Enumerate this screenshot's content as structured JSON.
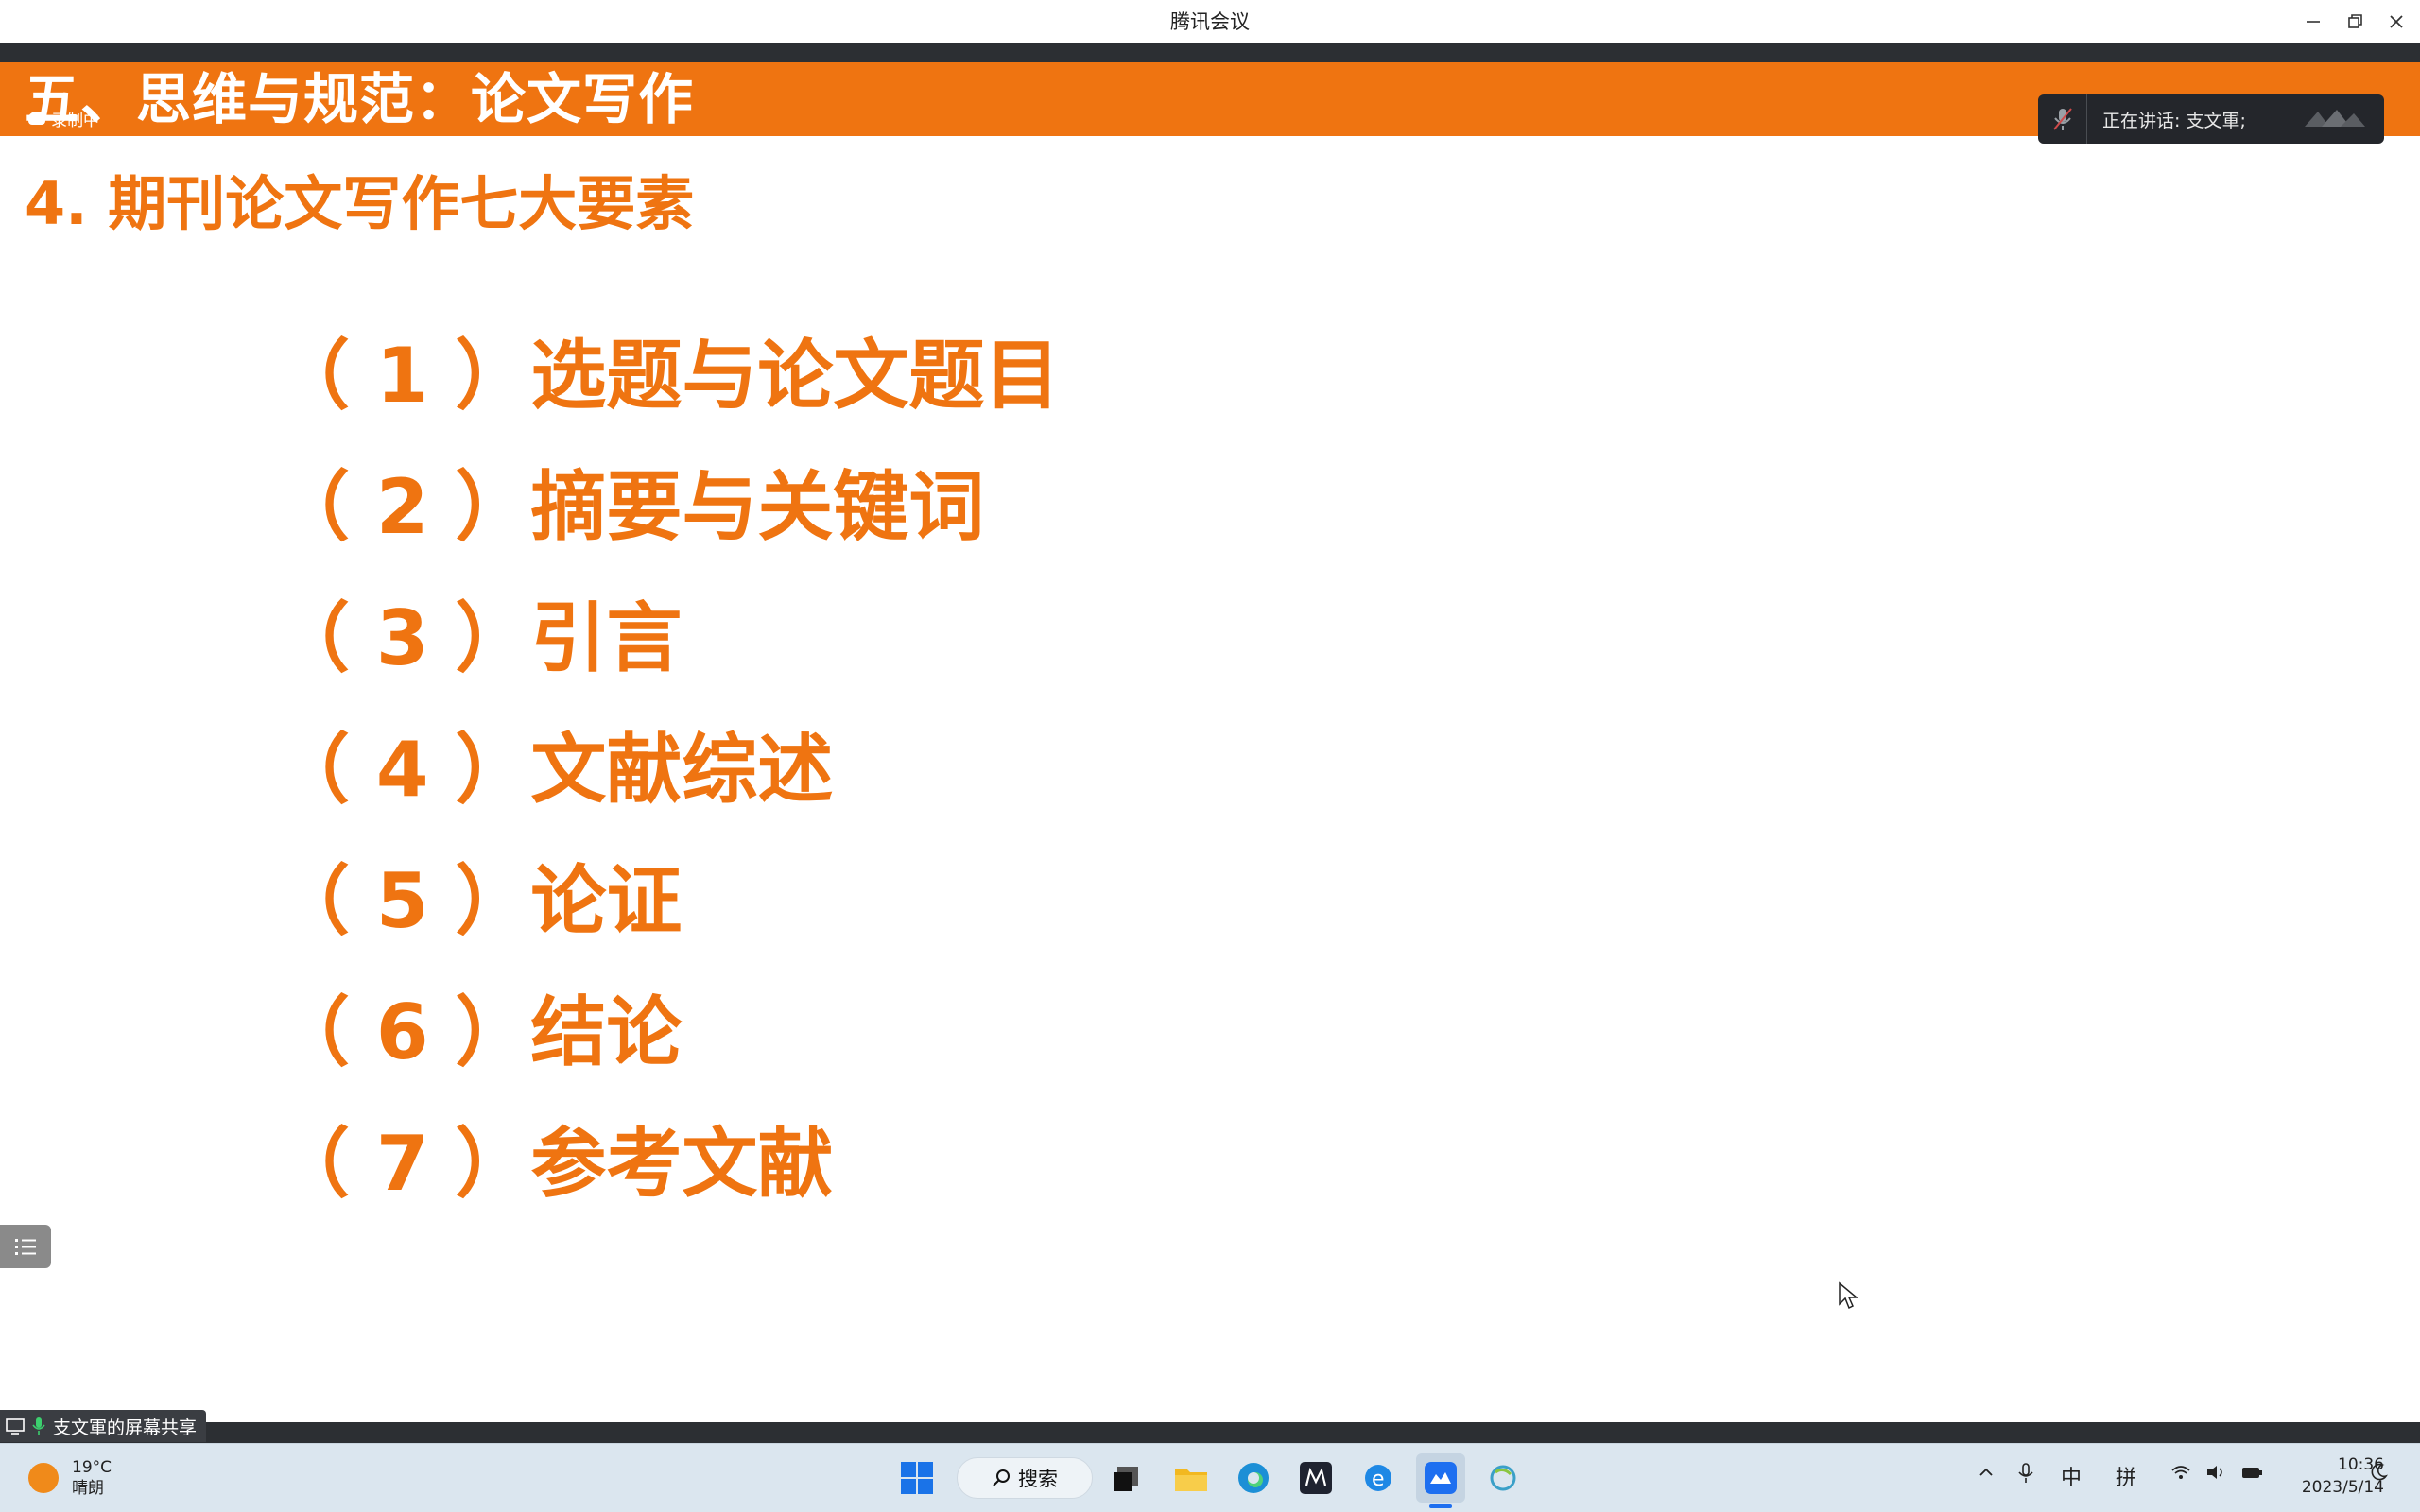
{
  "window": {
    "title": "腾讯会议",
    "controls": [
      "minimize-icon",
      "restore-icon",
      "close-icon"
    ]
  },
  "slide": {
    "header": "五、思维与规范：论文写作",
    "recording_label": "录制中",
    "subtitle": "4. 期刊论文写作七大要素",
    "items": [
      "（ 1 ）选题与论文题目",
      "（ 2 ）摘要与关键词",
      "（ 3 ）引言",
      "（ 4 ）文献综述",
      "（ 5 ）论证",
      "（ 6 ）结论",
      "（ 7 ）参考文献"
    ],
    "accent_color": "#ef7411"
  },
  "speaker_panel": {
    "label": "正在讲话: 支文軍;"
  },
  "share": {
    "label": "支文軍的屏幕共享"
  },
  "taskbar": {
    "weather_temp": "19°C",
    "weather_desc": "晴朗",
    "search_label": "搜索",
    "ime_lang": "中",
    "ime_mode": "拼",
    "time": "10:36",
    "date": "2023/5/14"
  }
}
